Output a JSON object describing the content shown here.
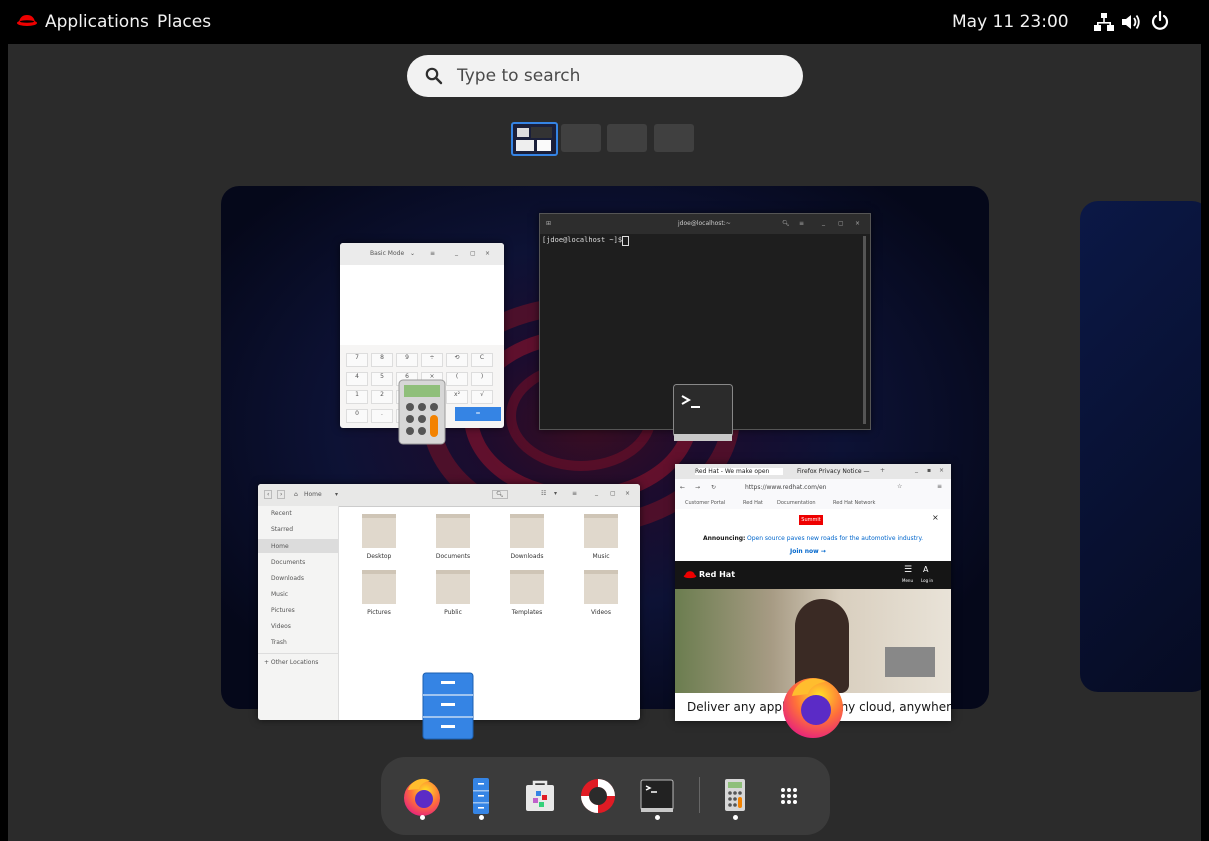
{
  "topbar": {
    "applications": "Applications",
    "places": "Places",
    "clock": "May 11  23:00"
  },
  "search": {
    "placeholder": "Type to search"
  },
  "workspaces": {
    "count": 4,
    "active_index": 0
  },
  "windows": {
    "calculator": {
      "mode": "Basic Mode",
      "keys": [
        "7",
        "8",
        "9",
        "÷",
        "⟲",
        "C",
        "4",
        "5",
        "6",
        "×",
        "(",
        ")",
        "1",
        "2",
        "3",
        "−",
        "x²",
        "√",
        "0",
        ".",
        "%",
        "+",
        "="
      ]
    },
    "terminal": {
      "title": "jdoe@localhost:~",
      "prompt": "[jdoe@localhost ~]$ "
    },
    "files": {
      "location": "Home",
      "sidebar": [
        "Recent",
        "Starred",
        "Home",
        "Documents",
        "Downloads",
        "Music",
        "Pictures",
        "Videos",
        "Trash",
        "+ Other Locations"
      ],
      "folders": [
        "Desktop",
        "Documents",
        "Downloads",
        "Music",
        "Pictures",
        "Public",
        "Templates",
        "Videos"
      ]
    },
    "firefox": {
      "tab1": "Red Hat - We make open",
      "tab2": "Firefox Privacy Notice —",
      "url": "https://www.redhat.com/en",
      "bookmarks": [
        "Customer Portal",
        "Red Hat",
        "Documentation",
        "Red Hat Network"
      ],
      "summit_badge": "Summit",
      "announcing_label": "Announcing:",
      "announcing_text": "Open source paves new roads for the automotive industry.",
      "join_now": "Join now →",
      "brand": "Red Hat",
      "menu_label": "Menu",
      "login_label": "Log in",
      "headline": "Deliver any application, any cloud, anywhere"
    }
  },
  "colors": {
    "topbar": "#000000",
    "overview_bg": "#2b2b2b",
    "dash_bg": "#3b3b3b",
    "redhat_red": "#ee0000",
    "workspace_active_border": "#3584e4"
  },
  "dash": {
    "apps": [
      "firefox-icon",
      "files-icon",
      "software-icon",
      "help-icon",
      "terminal-icon",
      "calculator-icon",
      "app-grid-icon"
    ]
  }
}
